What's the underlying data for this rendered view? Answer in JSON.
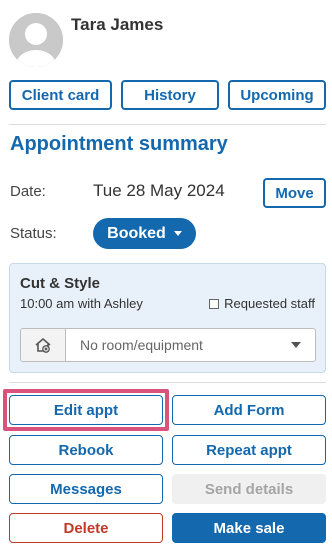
{
  "client": {
    "name": "Tara James"
  },
  "tabs": {
    "client_card": "Client card",
    "history": "History",
    "upcoming": "Upcoming"
  },
  "summary": {
    "title": "Appointment summary",
    "date_label": "Date:",
    "date_value": "Tue 28 May 2024",
    "move_label": "Move",
    "status_label": "Status:",
    "status_value": "Booked"
  },
  "service": {
    "name": "Cut & Style",
    "time": "10:00 am with Ashley",
    "requested_staff_label": "Requested staff",
    "requested_staff_checked": false,
    "room_placeholder": "No room/equipment"
  },
  "actions": {
    "edit_appt": "Edit appt",
    "add_form": "Add Form",
    "rebook": "Rebook",
    "repeat_appt": "Repeat appt",
    "messages": "Messages",
    "send_details": "Send details",
    "delete": "Delete",
    "make_sale": "Make sale"
  },
  "colors": {
    "accent": "#1468ad",
    "danger": "#c0392b",
    "highlight": "#d9537d",
    "card_bg": "#e8f0f9"
  },
  "icons": {
    "avatar": "user-silhouette-icon",
    "status_caret": "caret-down-icon",
    "room": "room-equipment-icon",
    "room_caret": "chevron-down-icon"
  }
}
